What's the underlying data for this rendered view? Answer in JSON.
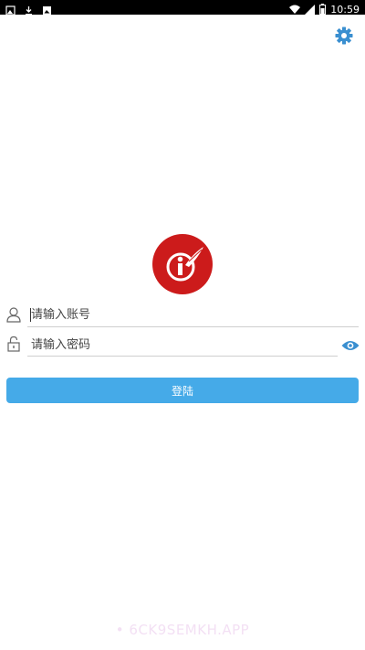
{
  "status_bar": {
    "time": "10:59",
    "left_icons": [
      "image-icon",
      "download-icon",
      "photo-icon"
    ],
    "right_icons": [
      "wifi-icon",
      "signal-icon",
      "battery-icon"
    ]
  },
  "login": {
    "account_placeholder": "请输入账号",
    "password_placeholder": "请输入密码",
    "login_label": "登陆"
  },
  "watermark": "6CK9SEMKH.APP",
  "colors": {
    "accent": "#45aae8",
    "logo_red": "#cc1b1b",
    "status_bar": "#000000"
  }
}
